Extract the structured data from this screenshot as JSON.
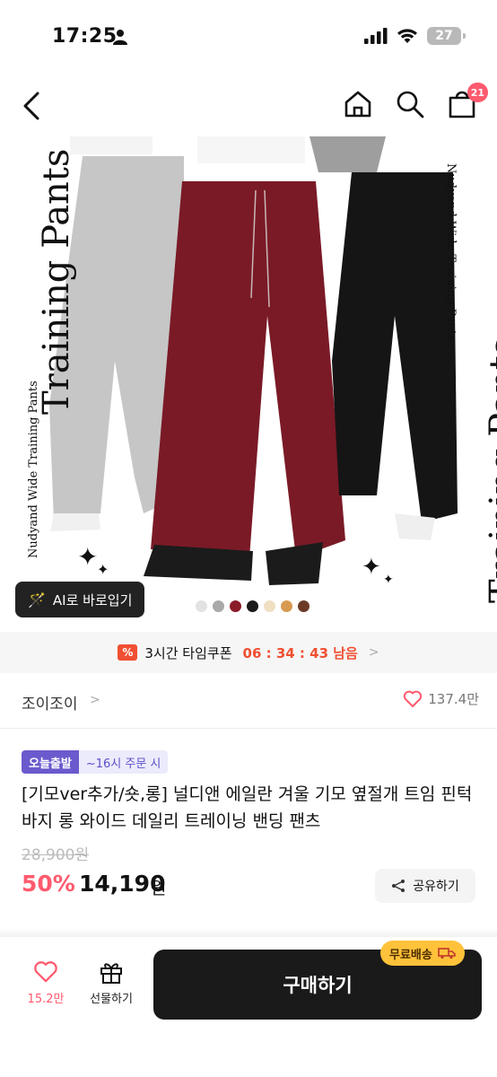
{
  "status_bar": {
    "time": "17:25",
    "battery": "27"
  },
  "nav": {
    "cart_count": "21"
  },
  "hero": {
    "title_big": "Training Pants",
    "title_small": "Nudyand Wide Training Pants",
    "ai_chip_label": "AI로 바로입기",
    "swatch_colors": [
      "#e2e2e2",
      "#a9a9a9",
      "#8a1c27",
      "#1a1a1a",
      "#efe0c2",
      "#d89a50",
      "#6b3a26"
    ]
  },
  "coupon": {
    "label": "3시간 타임쿠폰",
    "timer": "06 : 34 : 43 남음",
    "icon": "%"
  },
  "brand": {
    "name": "조이조이",
    "likes": "137.4만"
  },
  "product": {
    "badge_fast": "오늘출발",
    "badge_order": "~16시 주문 시",
    "title": "[기모ver추가/숏,롱] 널디앤 에일란 겨울 기모 옆절개 트임 핀턱 바지 롱 와이드 데일리 트레이닝 밴딩 팬츠",
    "original_price": "28,900원",
    "discount": "50%",
    "price": "14,190",
    "price_unit": "원",
    "share_label": "공유하기"
  },
  "bottom_bar": {
    "wish_count": "15.2만",
    "gift_label": "선물하기",
    "buy_label": "구매하기",
    "free_shipping": "무료배송"
  }
}
